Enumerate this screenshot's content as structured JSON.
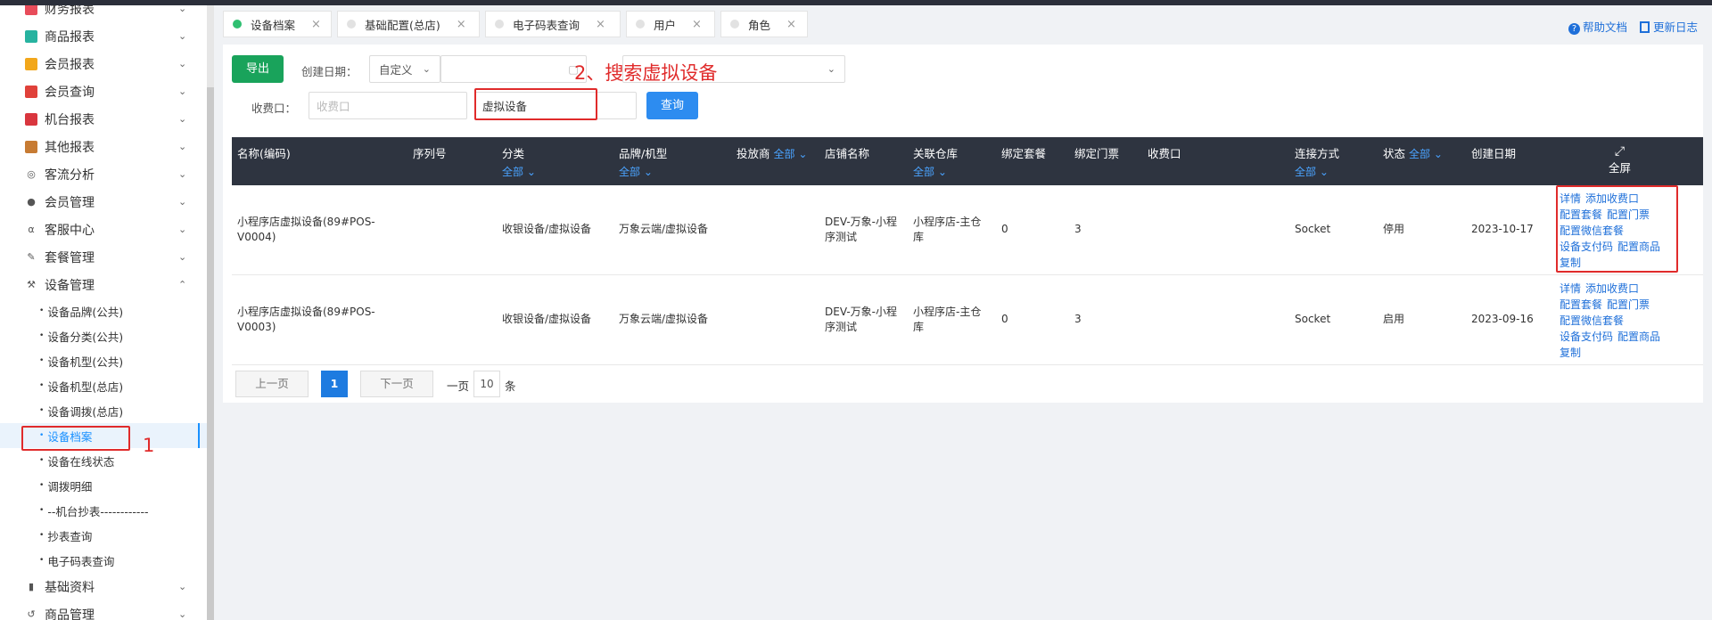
{
  "sidebar": {
    "items": [
      {
        "label": "财务报表",
        "icon": "finance-report-icon",
        "color": "#e84c5a"
      },
      {
        "label": "商品报表",
        "icon": "goods-report-icon",
        "color": "#27b3a0"
      },
      {
        "label": "会员报表",
        "icon": "member-report-icon",
        "color": "#f2a71b"
      },
      {
        "label": "会员查询",
        "icon": "member-query-icon",
        "color": "#e0413a"
      },
      {
        "label": "机台报表",
        "icon": "machine-report-icon",
        "color": "#d9363e"
      },
      {
        "label": "其他报表",
        "icon": "other-report-icon",
        "color": "#c77b33"
      },
      {
        "label": "客流分析",
        "icon": "traffic-analysis-icon",
        "color": "#555555"
      },
      {
        "label": "会员管理",
        "icon": "member-manage-icon",
        "color": "#555555"
      },
      {
        "label": "客服中心",
        "icon": "service-center-icon",
        "color": "#555555"
      },
      {
        "label": "套餐管理",
        "icon": "package-manage-icon",
        "color": "#555555"
      },
      {
        "label": "设备管理",
        "icon": "device-manage-icon",
        "color": "#555555"
      }
    ],
    "device_sub": [
      "设备品牌(公共)",
      "设备分类(公共)",
      "设备机型(公共)",
      "设备机型(总店)",
      "设备调拨(总店)",
      "设备档案",
      "设备在线状态",
      "调拨明细",
      "--机台抄表------------",
      "抄表查询",
      "电子码表查询"
    ],
    "bottom_items": [
      {
        "label": "基础资料",
        "icon": "basic-data-icon"
      },
      {
        "label": "商品管理",
        "icon": "goods-manage-icon"
      }
    ]
  },
  "annotations": {
    "step1": "1",
    "step2": "2、搜索虚拟设备"
  },
  "tabs": [
    {
      "label": "设备档案",
      "active": true
    },
    {
      "label": "基础配置(总店)",
      "active": false
    },
    {
      "label": "电子码表查询",
      "active": false
    },
    {
      "label": "用户",
      "active": false
    },
    {
      "label": "角色",
      "active": false
    }
  ],
  "help": {
    "docs": "帮助文档",
    "changelog": "更新日志"
  },
  "filters": {
    "export": "导出",
    "date_label": "创建日期：",
    "date_mode": "自定义",
    "cashier_label": "收费口：",
    "cashier_placeholder": "收费口",
    "search_value": "虚拟设备",
    "query": "查询"
  },
  "table": {
    "headers": {
      "name": "名称(编码)",
      "serial": "序列号",
      "category": "分类",
      "brand": "品牌/机型",
      "investor": "投放商",
      "store": "店铺名称",
      "warehouse": "关联仓库",
      "package": "绑定套餐",
      "ticket": "绑定门票",
      "cashier": "收费口",
      "connect": "连接方式",
      "status": "状态",
      "created": "创建日期",
      "fullscreen": "全屏",
      "all": "全部"
    },
    "rows": [
      {
        "name1": "小程序店虚拟设备(89#POS-",
        "name2": "V0004)",
        "category": "收银设备/虚拟设备",
        "brand": "万象云端/虚拟设备",
        "store1": "DEV-万象-小程",
        "store2": "序测试",
        "wh1": "小程序店-主仓",
        "wh2": "库",
        "package": "0",
        "ticket": "3",
        "connect": "Socket",
        "status": "停用",
        "created": "2023-10-17"
      },
      {
        "name1": "小程序店虚拟设备(89#POS-",
        "name2": "V0003)",
        "category": "收银设备/虚拟设备",
        "brand": "万象云端/虚拟设备",
        "store1": "DEV-万象-小程",
        "store2": "序测试",
        "wh1": "小程序店-主仓",
        "wh2": "库",
        "package": "0",
        "ticket": "3",
        "connect": "Socket",
        "status": "启用",
        "created": "2023-09-16"
      }
    ],
    "ops": {
      "detail": "详情",
      "add_cashier": "添加收费口",
      "cfg_package": "配置套餐",
      "cfg_ticket": "配置门票",
      "cfg_wechat": "配置微信套餐",
      "pay_code": "设备支付码",
      "cfg_goods": "配置商品",
      "copy": "复制"
    }
  },
  "pager": {
    "prev": "上一页",
    "current": "1",
    "next": "下一页",
    "per_page_prefix": "一页",
    "size": "10",
    "unit": "条"
  }
}
